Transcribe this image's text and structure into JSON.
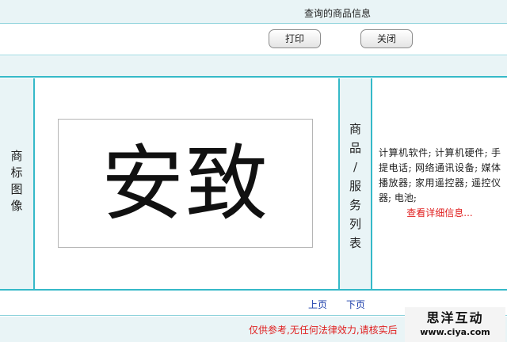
{
  "header": {
    "title": "查询的商品信息"
  },
  "toolbar": {
    "print_label": "打印",
    "close_label": "关闭"
  },
  "table": {
    "trademark_label_chars": [
      "商",
      "标",
      "图",
      "像"
    ],
    "trademark_text": "安致",
    "goods_label_chars": [
      "商",
      "品",
      "/",
      "服",
      "务",
      "列",
      "表"
    ],
    "goods_list": "计算机软件; 计算机硬件; 手提电话; 网络通讯设备; 媒体播放器; 家用遥控器; 遥控仪器; 电池;",
    "view_detail_label": "查看详细信息..."
  },
  "pager": {
    "prev_label": "上页",
    "next_label": "下页"
  },
  "footer": {
    "disclaimer": "仅供参考,无任何法律效力,请核实后"
  },
  "watermark": {
    "title": "思洋互动",
    "url": "www.ciya.com"
  }
}
